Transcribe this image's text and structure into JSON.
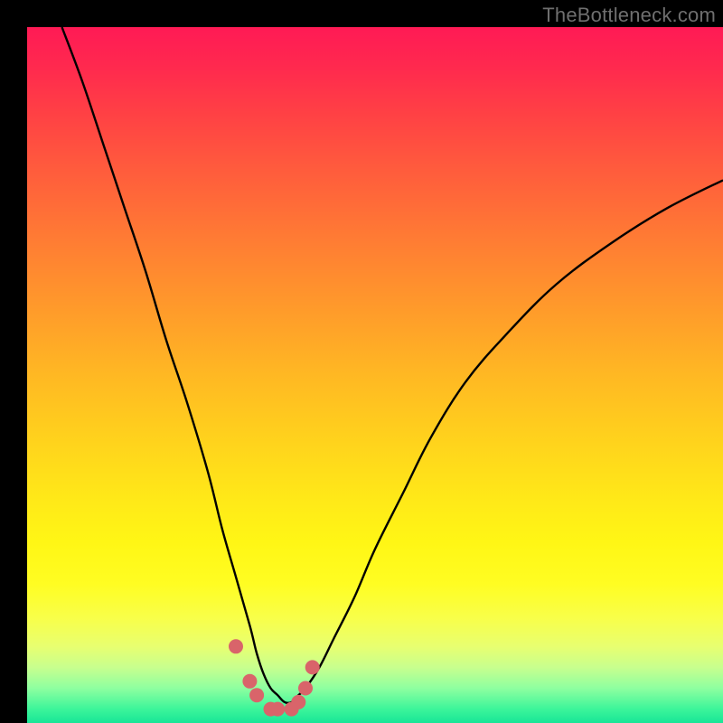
{
  "watermark": "TheBottleneck.com",
  "colors": {
    "curve": "#000000",
    "marker_fill": "#d9646a",
    "marker_stroke": "#b94a52",
    "bg_black": "#000000"
  },
  "chart_data": {
    "type": "line",
    "title": "",
    "xlabel": "",
    "ylabel": "",
    "xlim": [
      0,
      100
    ],
    "ylim": [
      0,
      100
    ],
    "grid": false,
    "legend": false,
    "series": [
      {
        "name": "bottleneck-curve",
        "x": [
          5,
          8,
          11,
          14,
          17,
          20,
          23,
          26,
          28,
          30,
          32,
          33,
          34,
          35,
          36,
          37,
          38,
          39,
          40,
          42,
          44,
          47,
          50,
          54,
          58,
          63,
          69,
          76,
          84,
          92,
          100
        ],
        "values": [
          100,
          92,
          83,
          74,
          65,
          55,
          46,
          36,
          28,
          21,
          14,
          10,
          7,
          5,
          4,
          3,
          3,
          4,
          5,
          8,
          12,
          18,
          25,
          33,
          41,
          49,
          56,
          63,
          69,
          74,
          78
        ]
      }
    ],
    "markers": {
      "name": "highlight-points",
      "x": [
        30,
        32,
        33,
        35,
        36,
        38,
        39,
        40,
        41
      ],
      "values": [
        11,
        6,
        4,
        2,
        2,
        2,
        3,
        5,
        8
      ]
    }
  }
}
